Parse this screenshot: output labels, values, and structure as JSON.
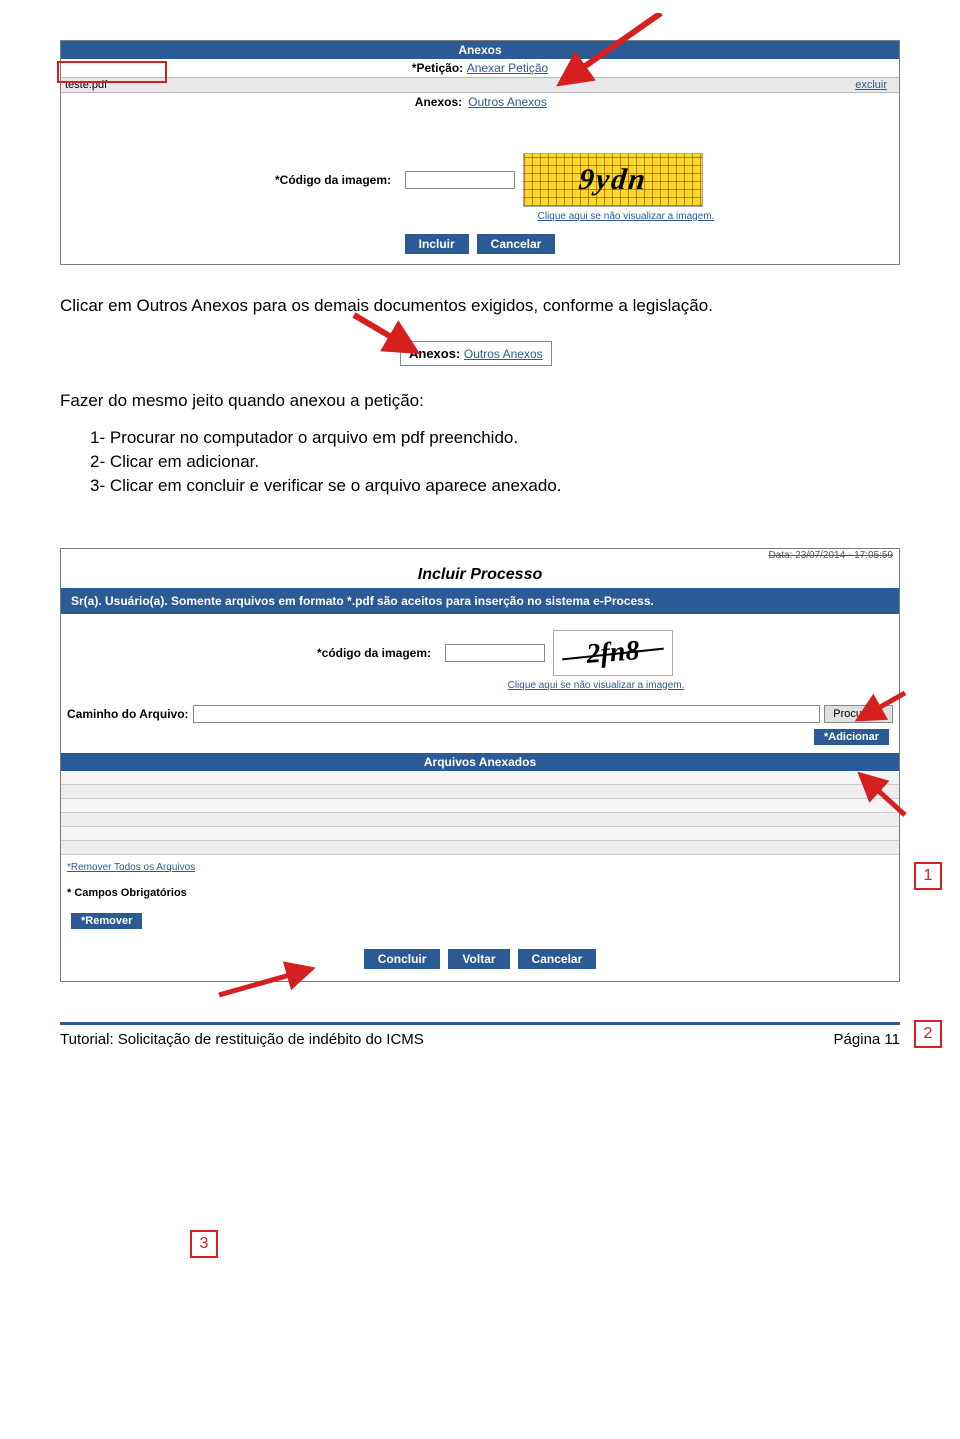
{
  "panel1": {
    "header": "Anexos",
    "peticao_label": "*Petição:",
    "peticao_link": "Anexar Petição",
    "file_name": "teste.pdf",
    "excluir": "excluir",
    "anexos_label": "Anexos:",
    "anexos_link": "Outros Anexos",
    "codigo_label": "*Código da imagem:",
    "captcha_text": "9ydn",
    "refresh_link": "Clique aqui se não visualizar a imagem.",
    "btn_incluir": "Incluir",
    "btn_cancelar": "Cancelar"
  },
  "text1": "Clicar em Outros Anexos para os demais documentos exigidos, conforme a legislação.",
  "snippet": {
    "label": "Anexos:",
    "link": "Outros Anexos"
  },
  "text2": "Fazer do mesmo jeito quando anexou a petição:",
  "steps": {
    "s1": "1- Procurar no computador o arquivo em pdf preenchido.",
    "s2": "2- Clicar em adicionar.",
    "s3": "3- Clicar em concluir e verificar se o arquivo aparece anexado."
  },
  "panel2": {
    "timestamp": "Data: 23/07/2014 - 17:05:59",
    "title": "Incluir Processo",
    "notice": "Sr(a). Usuário(a). Somente arquivos em formato *.pdf são aceitos para inserção no sistema e-Process.",
    "codigo_label": "*código da imagem:",
    "captcha_text": "2fn8",
    "refresh_link": "Clique aqui se não visualizar a imagem.",
    "caminho_label": "Caminho do Arquivo:",
    "btn_procurar": "Procurar...",
    "btn_adicionar": "*Adicionar",
    "arquivos_header": "Arquivos Anexados",
    "remover_todos": "*Remover Todos os Arquivos",
    "campos_obrig": "* Campos Obrigatórios",
    "btn_remover": "*Remover",
    "btn_concluir": "Concluir",
    "btn_voltar": "Voltar",
    "btn_cancelar": "Cancelar"
  },
  "callouts": {
    "c1": "1",
    "c2": "2",
    "c3": "3"
  },
  "footer": {
    "left": "Tutorial: Solicitação de restituição de indébito do ICMS",
    "right": "Página 11"
  }
}
